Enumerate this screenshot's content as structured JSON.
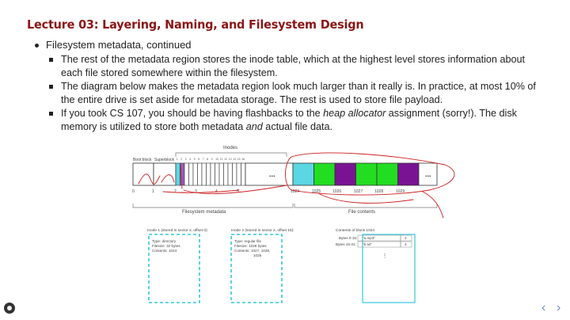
{
  "title": "Lecture 03: Layering, Naming, and Filesystem Design",
  "bullet": {
    "text": "Filesystem metadata, continued",
    "sub1": "The rest of the metadata region stores the inode table, which at the highest level stores information about each file stored somewhere within the filesystem.",
    "sub2": "The diagram below makes the metadata region look much larger than it really is. In practice, at most 10% of the entire drive is set aside for metadata storage. The rest is used to store file payload.",
    "sub3_a": "If you took CS 107, you should be having flashbacks to the ",
    "sub3_em1": "heap allocator",
    "sub3_b": " assignment (sorry!). The disk memory is utilized to store both metadata ",
    "sub3_em2": "and",
    "sub3_c": " actual file data."
  },
  "diagram": {
    "label_boot": "Boot block",
    "label_super": "Superblock",
    "label_inodes": "Inodes",
    "inode_nums": [
      "1",
      "2",
      "3",
      "4",
      "5",
      "6",
      "7",
      "8",
      "9",
      "10",
      "11",
      "12",
      "13",
      "14",
      "15",
      "16"
    ],
    "sector_nums": [
      "0",
      "1",
      "2",
      "3",
      "4",
      "5",
      "1024",
      "1025",
      "1026",
      "1027",
      "1028",
      "1029"
    ],
    "ellipsis": "...",
    "label_fs_meta": "Filesystem metadata",
    "label_file_contents": "File contents",
    "inode1_title": "Inode 1 (stored in sector 2, offset 0):",
    "inode1_lines": [
      "Type: directory",
      "Filesize: 32 bytes",
      "Contents: 1024"
    ],
    "inode2_title": "Inode 2 (stored in sector 2, offset 16):",
    "inode2_lines": [
      "Type: regular file",
      "Filesize: 1028 bytes",
      "Contents: 1027, 1028,",
      "1025"
    ],
    "block_title": "Contents of block 1024",
    "block_rows": [
      {
        "label": "Bytes 0-15:",
        "name": "\"a.mp3\"",
        "num": "2"
      },
      {
        "label": "Bytes 16-31:",
        "name": "\"b.txt\"",
        "num": "3"
      }
    ],
    "colors": {
      "cyan": "#5ad7e3",
      "green": "#22dd22",
      "purple": "#7a1294",
      "purple_light": "#9a5cc0",
      "annot": "#cc1f1f",
      "dashed": "#33c8d8"
    }
  },
  "nav": {
    "prev": "‹",
    "next": "›"
  }
}
